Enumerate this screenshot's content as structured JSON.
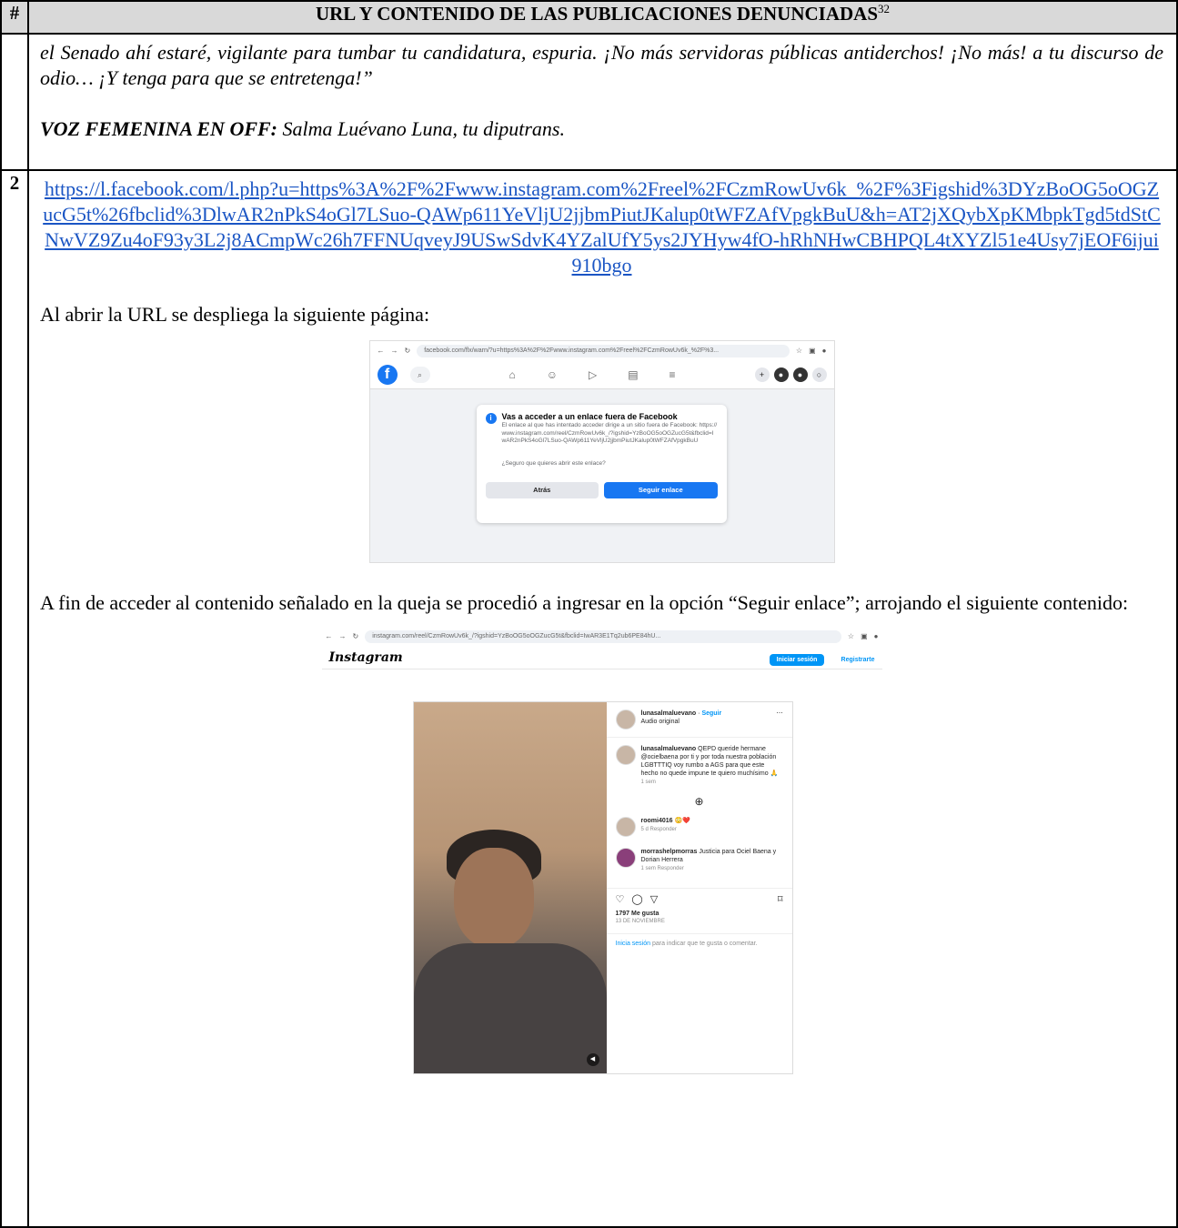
{
  "table": {
    "col_num_header": "#",
    "col_title_header": "URL Y CONTENIDO DE LAS PUBLICACIONES DENUNCIADAS",
    "footnote_ref": "32"
  },
  "row1": {
    "text": "el Senado ahí estaré, vigilante para tumbar tu candidatura, espuria. ¡No más servidoras públicas antiderchos! ¡No más! a tu discurso de odio… ¡Y tenga para que se entretenga!”",
    "voice_label": "VOZ FEMENINA EN OFF:",
    "voice_text": " Salma Luévano Luna, tu diputrans."
  },
  "row2": {
    "number": "2",
    "url": "https://l.facebook.com/l.php?u=https%3A%2F%2Fwww.instagram.com%2Freel%2FCzmRowUv6k_%2F%3Figshid%3DYzBoOG5oOGZucG5t%26fbclid%3DlwAR2nPkS4oGl7LSuo-QAWp611YeVljU2jjbmPiutJKalup0tWFZAfVpgkBuU&h=AT2jXQybXpKMbpkTgd5tdStCNwVZ9Zu4oF93y3L2j8ACmpWc26h7FFNUqveyJ9USwSdvK4YZalUfY5ys2JYHyw4fO-hRhNHwCBHPQL4tXYZl51e4Usy7jEOF6ijui910bgo",
    "para1": "Al abrir la URL se despliega la siguiente página:",
    "para2": "A fin de acceder al contenido señalado en la queja se procedió a ingresar en la opción “Seguir enlace”; arrojando el siguiente contenido:"
  },
  "screenshot1": {
    "url": "facebook.com/flx/warn/?u=https%3A%2F%2Fwww.instagram.com%2Freel%2FCzmRowUv6k_%2F%3...",
    "dialog_title": "Vas a acceder a un enlace fuera de Facebook",
    "dialog_text": "El enlace al que has intentado acceder dirige a un sitio fuera de Facebook: https://www.instagram.com/reel/CzmRowUv6k_/?igshid=YzBoOG5oOGZucG5t&fbclid=IwAR2nPkS4oGl7LSuo-QAWp611YeVljU2jjbmPiutJKalup0tWFZAfVpgkBuU",
    "question": "¿Seguro que quieres abrir este enlace?",
    "back_label": "Atrás",
    "follow_label": "Seguir enlace"
  },
  "screenshot2": {
    "url": "instagram.com/reel/CzmRowUv6k_/?igshid=YzBoOG5oOGZucG5t&fbclid=IwAR3E1Tq2ub6PE84hU...",
    "logo": "Instagram",
    "login_label": "Iniciar sesión",
    "register_label": "Registrarte",
    "author": "lunasalmaluevano",
    "follow": "Seguir",
    "audio": "Audio original",
    "caption": "QEPD queride hermane @ocielbaena por ti y por toda nuestra población LGBTTTIQ voy rumbo a AGS para que este hecho no quede impune te quiero muchísimo 🙏",
    "caption_time": "1 sem",
    "comment1_user": "roomi4016",
    "comment1_text": "😳❤️",
    "comment1_meta": "5 d   Responder",
    "comment2_user": "morrashelpmorras",
    "comment2_text": "Justicia para Ociel Baena y Dorian Herrera",
    "comment2_meta": "1 sem   Responder",
    "likes": "1797 Me gusta",
    "date": "13 DE NOVIEMBRE",
    "login_prompt_link": "Inicia sesión",
    "login_prompt_text": " para indicar que te gusta o comentar."
  }
}
